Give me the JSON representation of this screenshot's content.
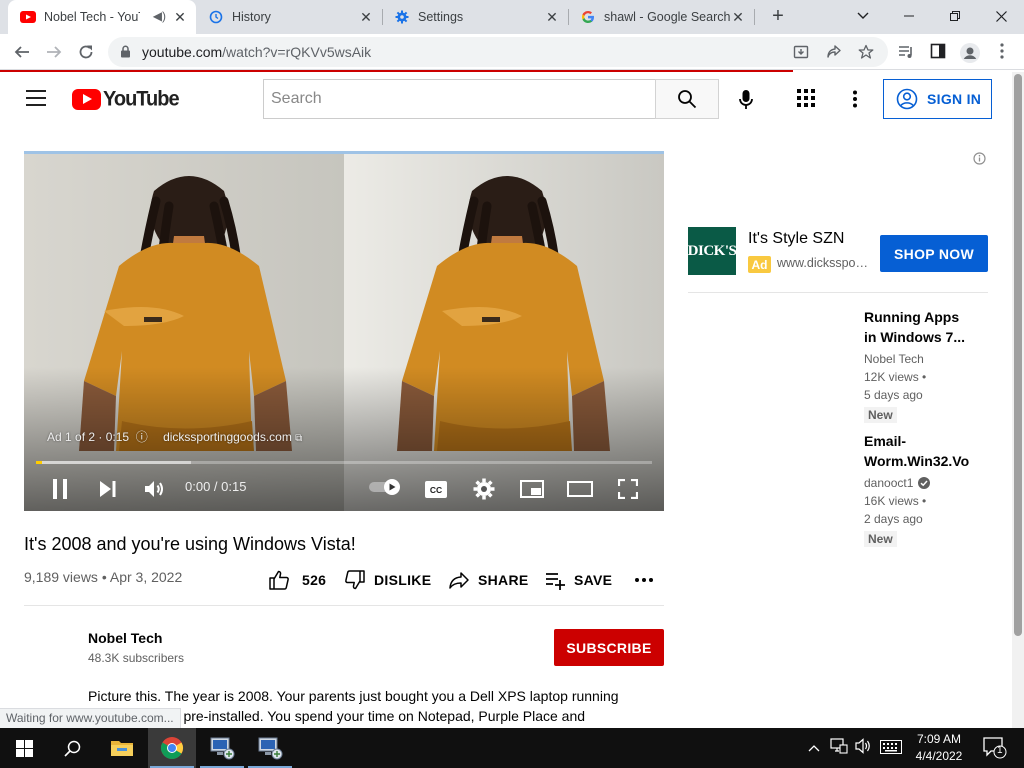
{
  "browser": {
    "tabs": [
      {
        "title": "Nobel Tech - YouTube",
        "active": true
      },
      {
        "title": "History",
        "active": false
      },
      {
        "title": "Settings",
        "active": false
      },
      {
        "title": "shawl - Google Search",
        "active": false
      }
    ],
    "url_host": "youtube.com",
    "url_path": "/watch?v=rQKVv5wsAik",
    "status_text": "Waiting for www.youtube.com..."
  },
  "youtube": {
    "logo_text": "YouTube",
    "search_placeholder": "Search",
    "sign_in_label": "SIGN IN"
  },
  "player": {
    "ad_label": "Ad 1 of 2 · 0:15",
    "ad_domain": "dickssportinggoods.com",
    "time_display": "0:00 / 0:15",
    "progress_fraction": 0.0
  },
  "video": {
    "title": "It's 2008 and you're using Windows Vista!",
    "views": "9,189 views",
    "date": "Apr 3, 2022",
    "likes": "526",
    "dislike_label": "DISLIKE",
    "share_label": "SHARE",
    "save_label": "SAVE"
  },
  "channel": {
    "name": "Nobel Tech",
    "subscribers": "48.3K subscribers",
    "subscribe_label": "SUBSCRIBE"
  },
  "description": {
    "line1": "Picture this. The year is 2008. Your parents just bought you a Dell XPS laptop running",
    "line2": "Windows Vista pre-installed. You spend your time on Notepad, Purple Place and"
  },
  "sidebar": {
    "ad": {
      "logo_text": "DICK'S",
      "title": "It's Style SZN",
      "badge": "Ad",
      "url": "www.dickssportinggoods.com",
      "cta": "SHOP NOW"
    },
    "recommendations": [
      {
        "title_line1": "Running Apps",
        "title_line2": "in Windows 7...",
        "channel": "Nobel Tech",
        "verified": false,
        "views": "12K views •",
        "age": "5 days ago",
        "badge": "New"
      },
      {
        "title_line1": "Email-",
        "title_line2": "Worm.Win32.Vo",
        "channel": "danooct1",
        "verified": true,
        "views": "16K views •",
        "age": "2 days ago",
        "badge": "New"
      }
    ]
  },
  "taskbar": {
    "time": "7:09 AM",
    "date": "4/4/2022",
    "notification_count": "1"
  },
  "colors": {
    "youtube_red": "#ff0000",
    "subscribe_red": "#cc0000",
    "link_blue": "#065fd4",
    "progress_yellow": "#ffcc00"
  }
}
